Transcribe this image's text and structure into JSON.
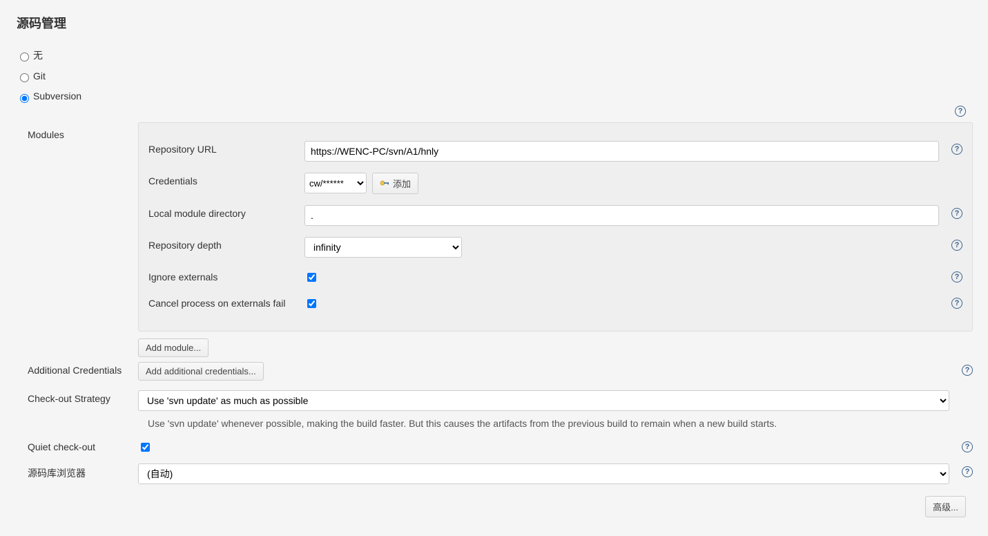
{
  "title": "源码管理",
  "scm": {
    "none": "无",
    "git": "Git",
    "subversion": "Subversion"
  },
  "modules": {
    "label": "Modules",
    "repoUrlLabel": "Repository URL",
    "repoUrlValue": "https://WENC-PC/svn/A1/hnly",
    "credentialsLabel": "Credentials",
    "credentialsValue": "cw/******",
    "addBtn": "添加",
    "localDirLabel": "Local module directory",
    "localDirValue": ".",
    "depthLabel": "Repository depth",
    "depthValue": "infinity",
    "ignoreExternalsLabel": "Ignore externals",
    "cancelOnFailLabel": "Cancel process on externals fail",
    "addModuleBtn": "Add module..."
  },
  "additionalCreds": {
    "label": "Additional Credentials",
    "btn": "Add additional credentials..."
  },
  "checkout": {
    "label": "Check-out Strategy",
    "value": "Use 'svn update' as much as possible",
    "desc": "Use 'svn update' whenever possible, making the build faster. But this causes the artifacts from the previous build to remain when a new build starts."
  },
  "quiet": {
    "label": "Quiet check-out"
  },
  "browser": {
    "label": "源码库浏览器",
    "value": "(自动)"
  },
  "advancedBtn": "高级..."
}
